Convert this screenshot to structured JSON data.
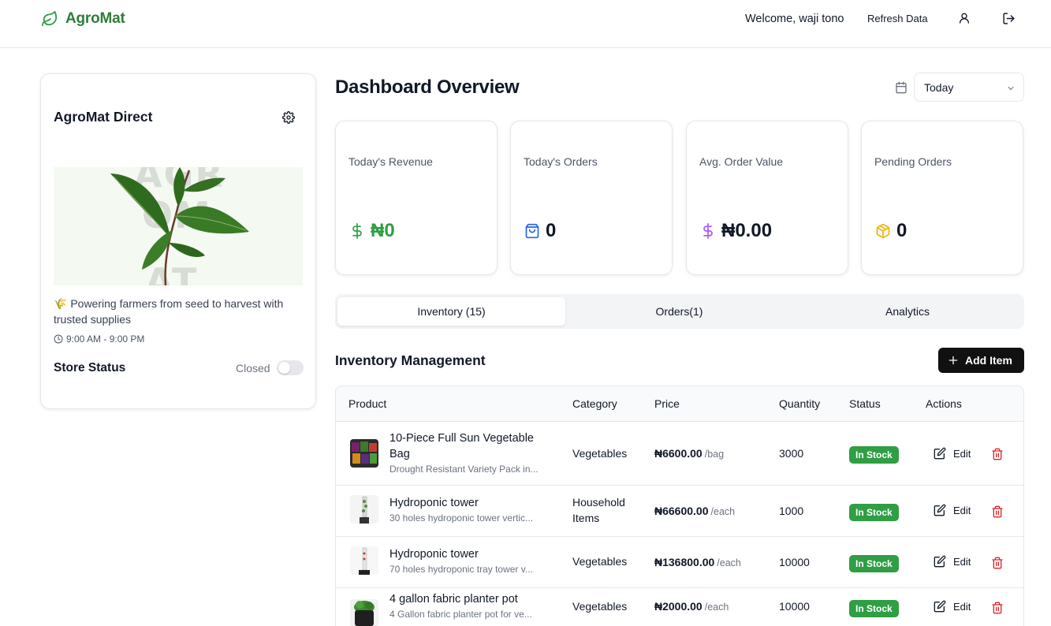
{
  "header": {
    "brand": "AgroMat",
    "welcome": "Welcome, waji tono",
    "refresh_label": "Refresh Data"
  },
  "store": {
    "name": "AgroMat Direct",
    "banner_watermark": [
      "AGR",
      "OM",
      "AT"
    ],
    "tagline": "🌾 Powering farmers from seed to harvest with trusted supplies",
    "hours": "9:00 AM - 9:00 PM",
    "status_label": "Store Status",
    "status_value": "Closed",
    "is_open": false
  },
  "dashboard": {
    "title": "Dashboard Overview",
    "period": "Today"
  },
  "stats": [
    {
      "label": "Today's Revenue",
      "value": "₦0",
      "icon": "dollar-icon",
      "color": "#2f9e44"
    },
    {
      "label": "Today's Orders",
      "value": "0",
      "icon": "shopping-bag-icon",
      "color": "#2563eb"
    },
    {
      "label": "Avg. Order Value",
      "value": "₦0.00",
      "icon": "dollar-icon",
      "color": "#a855f7"
    },
    {
      "label": "Pending Orders",
      "value": "0",
      "icon": "package-icon",
      "color": "#eab308"
    }
  ],
  "tabs": [
    {
      "label": "Inventory (15)",
      "active": true
    },
    {
      "label": "Orders(1)",
      "active": false
    },
    {
      "label": "Analytics",
      "active": false
    }
  ],
  "inventory": {
    "title": "Inventory Management",
    "add_label": "Add Item",
    "columns": [
      "Product",
      "Category",
      "Price",
      "Quantity",
      "Status",
      "Actions"
    ],
    "edit_label": "Edit",
    "rows": [
      {
        "name": "10-Piece Full Sun Vegetable Bag",
        "desc": "Drought Resistant Variety Pack in...",
        "category": "Vegetables",
        "price": "₦6600.00",
        "unit": "/bag",
        "quantity": "3000",
        "status": "In Stock"
      },
      {
        "name": "Hydroponic tower",
        "desc": "30 holes hydroponic tower vertic...",
        "category": "Household Items",
        "price": "₦66600.00",
        "unit": "/each",
        "quantity": "1000",
        "status": "In Stock"
      },
      {
        "name": "Hydroponic tower",
        "desc": "70 holes hydroponic tray tower v...",
        "category": "Vegetables",
        "price": "₦136800.00",
        "unit": "/each",
        "quantity": "10000",
        "status": "In Stock"
      },
      {
        "name": "4 gallon fabric planter pot",
        "desc": "4 Gallon fabric planter pot for ve...",
        "category": "Vegetables",
        "price": "₦2000.00",
        "unit": "/each",
        "quantity": "10000",
        "status": "In Stock"
      }
    ]
  }
}
